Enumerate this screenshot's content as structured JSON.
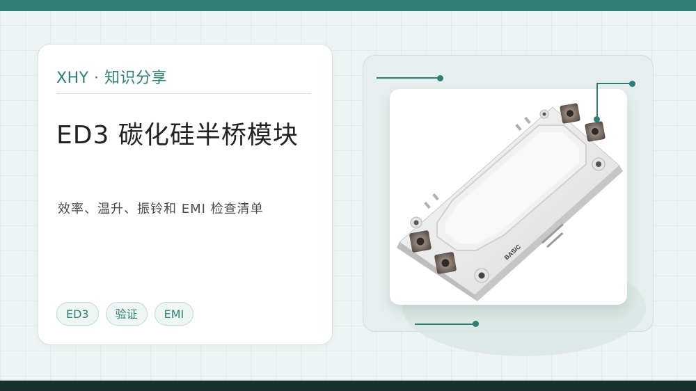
{
  "brand": "XHY · 知识分享",
  "title": "ED3 碳化硅半桥模块",
  "subtitle": "效率、温升、振铃和 EMI 检查清单",
  "tags": [
    "ED3",
    "验证",
    "EMI"
  ],
  "product_marking": "BASiC",
  "colors": {
    "accent": "#2d7f74",
    "top_bar": "#2d7f74",
    "bottom_bar": "#17302d",
    "background": "#eef4f3"
  }
}
